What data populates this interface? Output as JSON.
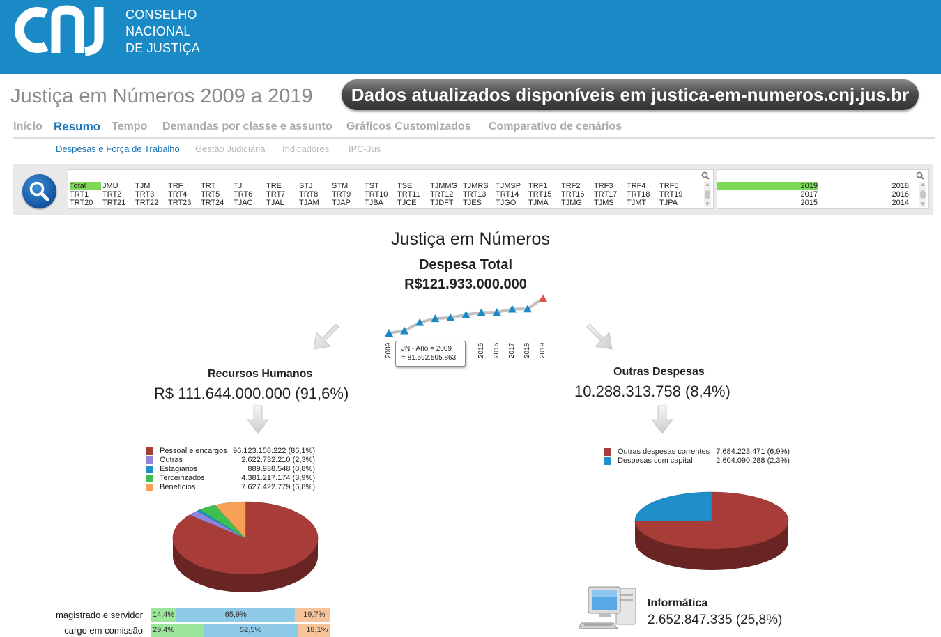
{
  "header": {
    "logo_lines": [
      "CONSELHO",
      "NACIONAL",
      "DE JUSTIÇA"
    ],
    "brand_color": "#1a8ac6"
  },
  "page_title": "Justiça em Números 2009 a 2019",
  "banner": "Dados atualizados disponíveis em justica-em-numeros.cnj.jus.br",
  "nav": {
    "tabs": [
      "Início",
      "Resumo",
      "Tempo",
      "Demandas por classe e assunto",
      "Gráficos Customizados",
      "Comparativo de cenários"
    ],
    "active": "Resumo"
  },
  "subnav": {
    "tabs": [
      "Despesas e Força de Trabalho",
      "Gestão Judiciária",
      "Indicadores",
      "IPC-Jus"
    ],
    "active": "Despesas e Força de Trabalho"
  },
  "filters": {
    "orgaos": [
      [
        "Total",
        "JMU",
        "TJM",
        "TRF",
        "TRT",
        "TJ",
        "TRE",
        "STJ",
        "STM",
        "TST",
        "TSE",
        "TJMMG",
        "TJMRS",
        "TJMSP",
        "TRF1",
        "TRF2",
        "TRF3",
        "TRF4",
        "TRF5"
      ],
      [
        "TRT1",
        "TRT2",
        "TRT3",
        "TRT4",
        "TRT5",
        "TRT6",
        "TRT7",
        "TRT8",
        "TRT9",
        "TRT10",
        "TRT11",
        "TRT12",
        "TRT13",
        "TRT14",
        "TRT15",
        "TRT16",
        "TRT17",
        "TRT18",
        "TRT19"
      ],
      [
        "TRT20",
        "TRT21",
        "TRT22",
        "TRT23",
        "TRT24",
        "TJAC",
        "TJAL",
        "TJAM",
        "TJAP",
        "TJBA",
        "TJCE",
        "TJDFT",
        "TJES",
        "TJGO",
        "TJMA",
        "TJMG",
        "TJMS",
        "TJMT",
        "TJPA"
      ]
    ],
    "selected_orgao": "Total",
    "anos": [
      [
        "2019",
        "2018"
      ],
      [
        "2017",
        "2016"
      ],
      [
        "2015",
        "2014"
      ]
    ],
    "selected_ano": "2019",
    "selection_color": "#7ed957"
  },
  "main_title": "Justiça em Números",
  "despesa_total": {
    "label": "Despesa Total",
    "value": "R$121.933.000.000"
  },
  "tooltip": {
    "line1": "JN - Ano = 2009",
    "line2": "= 81.592.505.863"
  },
  "chart_data": [
    {
      "type": "line",
      "title": "",
      "x": [
        "2009",
        "2010",
        "2011",
        "2012",
        "2013",
        "2014",
        "2015",
        "2016",
        "2017",
        "2018",
        "2019"
      ],
      "x_tick_labels_visible": [
        "2009",
        "2015",
        "2016",
        "2017",
        "2018",
        "2019"
      ],
      "series": [
        {
          "values": [
            81592505863,
            84400000000,
            94000000000,
            98500000000,
            99500000000,
            103000000000,
            105500000000,
            105800000000,
            109500000000,
            109700000000,
            121933000000
          ]
        }
      ],
      "highlight_point": "2019",
      "marker_color": "#1a8ac6",
      "highlight_color": "#d9574a",
      "line_color": "#c0c0c0"
    },
    {
      "type": "pie",
      "title": "Recursos Humanos",
      "categories": [
        "Pessoal e encargos",
        "Outras",
        "Estagiários",
        "Terceirizados",
        "Benefícios"
      ],
      "values": [
        96123158222,
        2622732210,
        889938548,
        4381217174,
        7627422779
      ],
      "value_labels": [
        "96.123.158.222 (86,1%)",
        "2.622.732.210 (2,3%)",
        "889.938.548 (0,8%)",
        "4.381.217.174 (3,9%)",
        "7.627.422.779 (6,8%)"
      ],
      "colors": [
        "#a83c38",
        "#8f86d9",
        "#1f8fc9",
        "#3fbf4f",
        "#f7a158"
      ]
    },
    {
      "type": "pie",
      "title": "Outras Despesas",
      "categories": [
        "Outras despesas correntes",
        "Despesas com capital"
      ],
      "values": [
        7684223471,
        2604090288
      ],
      "value_labels": [
        "7.684.223.471 (6,9%)",
        "2.604.090.288 (2,3%)"
      ],
      "colors": [
        "#a83c38",
        "#1f8fc9"
      ]
    },
    {
      "type": "bar",
      "stacked": true,
      "categories": [
        "magistrado e servidor",
        "cargo em comissão"
      ],
      "series": [
        {
          "values": [
            14.4,
            29.4
          ],
          "labels": [
            "14,4%",
            "29,4%"
          ],
          "color": "#9ce69c"
        },
        {
          "values": [
            65.9,
            52.5
          ],
          "labels": [
            "65,9%",
            "52,5%"
          ],
          "color": "#8ecae6"
        },
        {
          "values": [
            19.7,
            18.1
          ],
          "labels": [
            "19,7%",
            "18,1%"
          ],
          "color": "#f7c49a"
        }
      ]
    }
  ],
  "recursos_humanos": {
    "title": "Recursos Humanos",
    "value": "R$ 111.644.000.000 (91,6%)"
  },
  "outras_despesas": {
    "title": "Outras Despesas",
    "value": "10.288.313.758 (8,4%)"
  },
  "informatica": {
    "title": "Informática",
    "value": "2.652.847.335 (25,8%)"
  }
}
